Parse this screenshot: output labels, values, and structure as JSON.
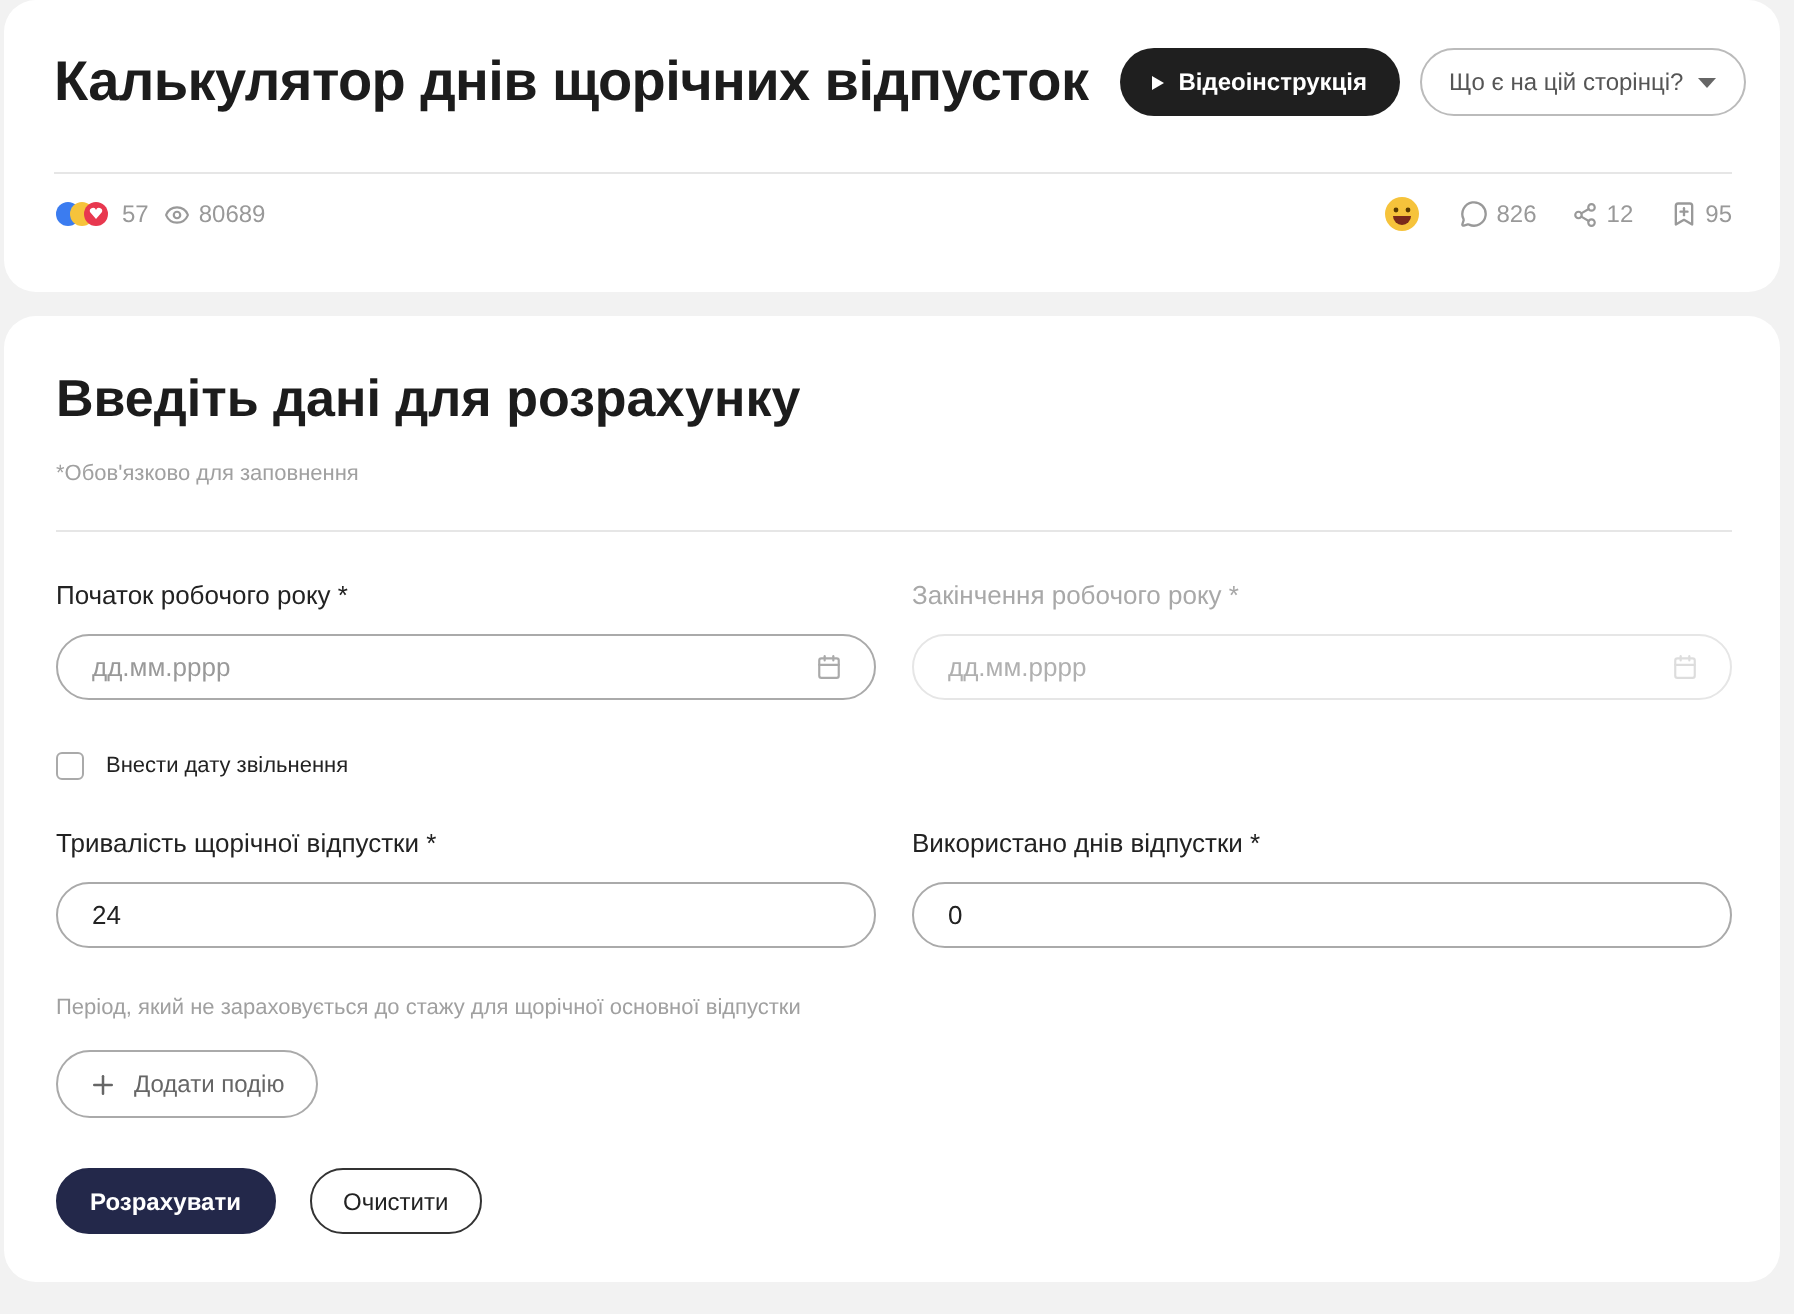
{
  "header": {
    "title": "Калькулятор днів щорічних відпусток",
    "video_button": "Відеоінструкція",
    "menu_button": "Що є на цій сторінці?"
  },
  "stats": {
    "reactions": "57",
    "views": "80689",
    "comments": "826",
    "shares": "12",
    "bookmarks": "95"
  },
  "form": {
    "title": "Введіть дані для розрахунку",
    "required_note": "*Обов'язково для заповнення",
    "date_fields": [
      {
        "label": "Початок робочого року *",
        "placeholder": "дд.мм.рррр",
        "disabled": false
      },
      {
        "label": "Закінчення робочого року *",
        "placeholder": "дд.мм.рррр",
        "disabled": true
      }
    ],
    "dismissal_checkbox": {
      "label": "Внести дату звільнення",
      "checked": false
    },
    "number_fields": [
      {
        "label": "Тривалість щорічної відпустки *",
        "value": "24"
      },
      {
        "label": "Використано днів відпустки *",
        "value": "0"
      }
    ],
    "period_note": "Період, який не зараховується до стажу для щорічної основної відпустки",
    "add_event_button": "Додати подію",
    "buttons": [
      {
        "label": "Розрахувати",
        "kind": "primary"
      },
      {
        "label": "Очистити",
        "kind": "secondary"
      }
    ]
  }
}
